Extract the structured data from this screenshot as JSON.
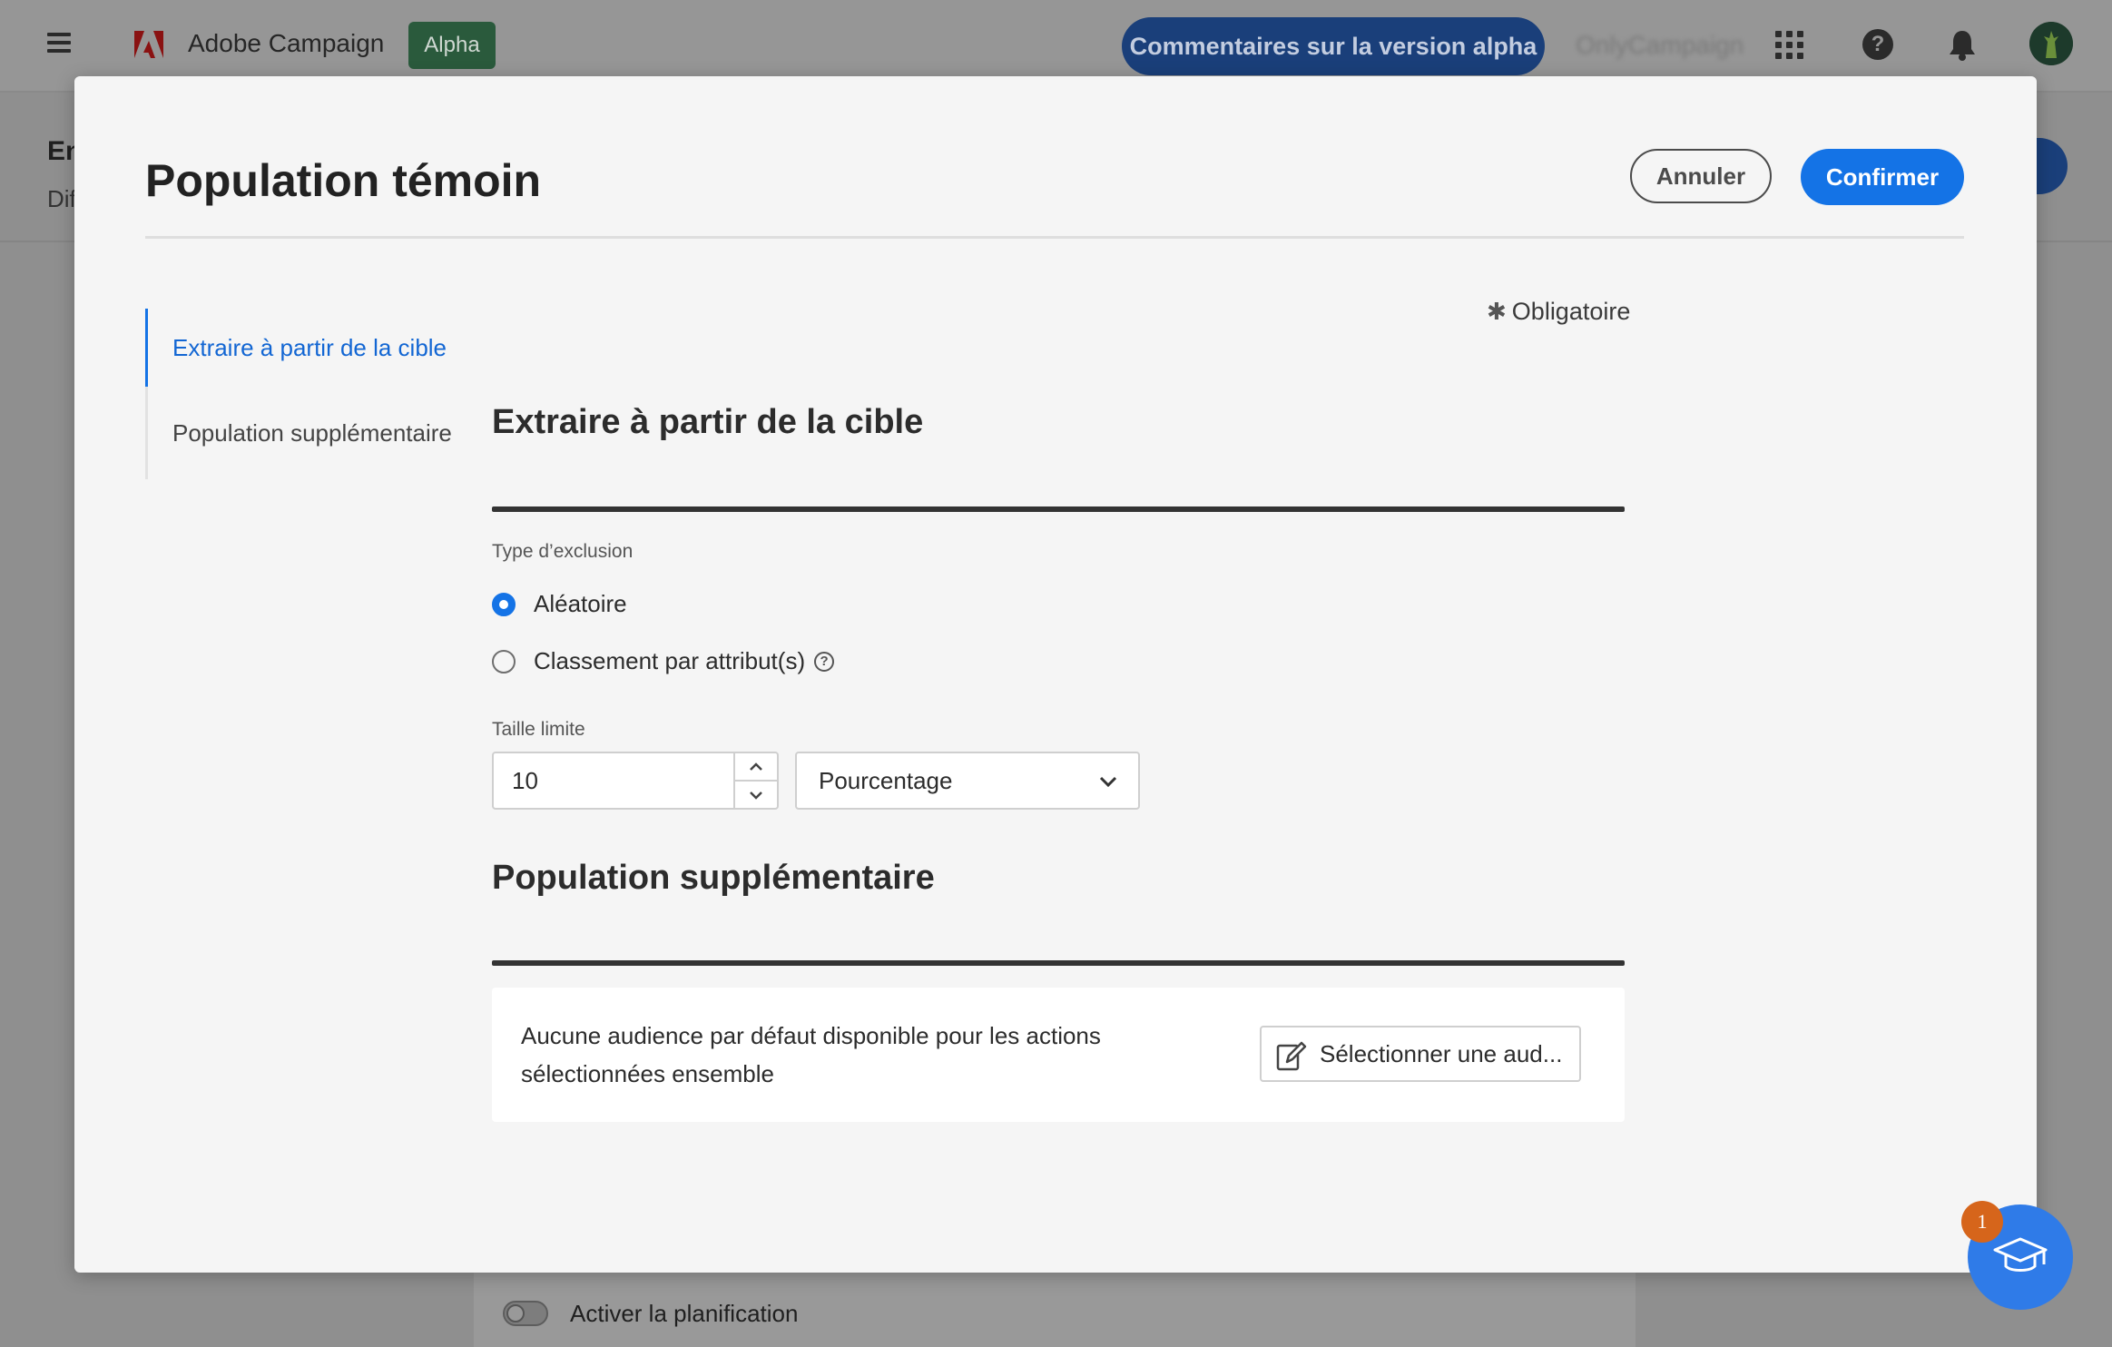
{
  "app": {
    "name": "Adobe Campaign",
    "badge": "Alpha",
    "feedback_button": "Commentaires sur la version alpha",
    "org_name": "OnlyCampaign",
    "icons": [
      "menu-icon",
      "adobe-logo",
      "apps-grid-icon",
      "help-icon",
      "bell-icon",
      "avatar"
    ]
  },
  "background": {
    "title_fragment": "En",
    "subtitle_fragment": "Dif",
    "schedule_toggle_label": "Activer la planification",
    "schedule_toggle_on": false
  },
  "modal": {
    "title": "Population témoin",
    "cancel_label": "Annuler",
    "confirm_label": "Confirmer",
    "required_note": "Obligatoire",
    "nav": {
      "items": [
        {
          "label": "Extraire à partir de la cible",
          "active": true
        },
        {
          "label": "Population supplémentaire",
          "active": false
        }
      ]
    },
    "extract_section": {
      "title": "Extraire à partir de la cible",
      "exclusion_type_label": "Type d’exclusion",
      "options": [
        {
          "label": "Aléatoire",
          "selected": true
        },
        {
          "label": "Classement par attribut(s)",
          "selected": false
        }
      ],
      "size_limit_label": "Taille limite",
      "size_limit_value": "10",
      "unit_selected": "Pourcentage"
    },
    "additional_section": {
      "title": "Population supplémentaire",
      "empty_message": "Aucune audience par défaut disponible pour les actions sélectionnées ensemble",
      "select_audience_label": "Sélectionner une aud..."
    }
  },
  "learn_fab": {
    "badge_count": "1",
    "icon": "graduation-cap-icon"
  },
  "colors": {
    "accent": "#1473e6",
    "active_nav_text": "#1266d3",
    "alpha_badge": "#2a5a3c",
    "fab": "#2f7be8",
    "fab_badge": "#d6651b"
  }
}
